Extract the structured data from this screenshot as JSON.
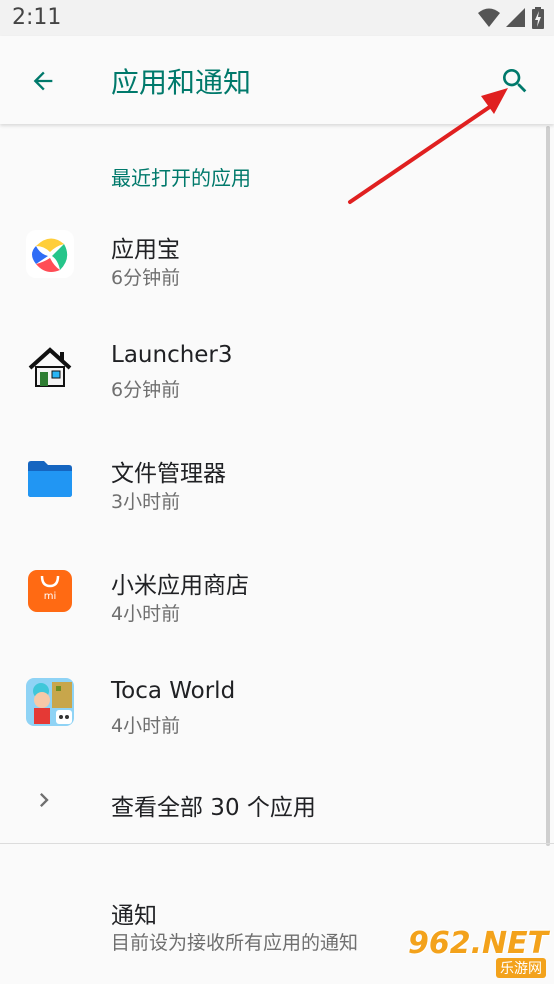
{
  "status_bar": {
    "time": "2:11",
    "icons": [
      "wifi-icon",
      "signal-icon",
      "battery-charging-icon"
    ]
  },
  "toolbar": {
    "title": "应用和通知",
    "back_icon": "arrow-left-icon",
    "search_icon": "search-icon"
  },
  "recent_section": {
    "header": "最近打开的应用"
  },
  "recent_apps": [
    {
      "name": "应用宝",
      "time": "6分钟前",
      "icon": "yingyongbao-icon"
    },
    {
      "name": "Launcher3",
      "time": "6分钟前",
      "icon": "launcher-house-icon"
    },
    {
      "name": "文件管理器",
      "time": "3小时前",
      "icon": "folder-icon"
    },
    {
      "name": "小米应用商店",
      "time": "4小时前",
      "icon": "mi-store-bag-icon"
    },
    {
      "name": "Toca World",
      "time": "4小时前",
      "icon": "toca-world-icon"
    }
  ],
  "see_all": {
    "label": "查看全部 30 个应用",
    "icon": "chevron-right-icon"
  },
  "notifications": {
    "title": "通知",
    "subtitle": "目前设为接收所有应用的通知"
  },
  "watermark": {
    "text": "962.NET",
    "sub": "乐游网"
  },
  "colors": {
    "accent": "#00796b",
    "annotation_arrow": "#e02020",
    "watermark": "#f3a21b"
  }
}
